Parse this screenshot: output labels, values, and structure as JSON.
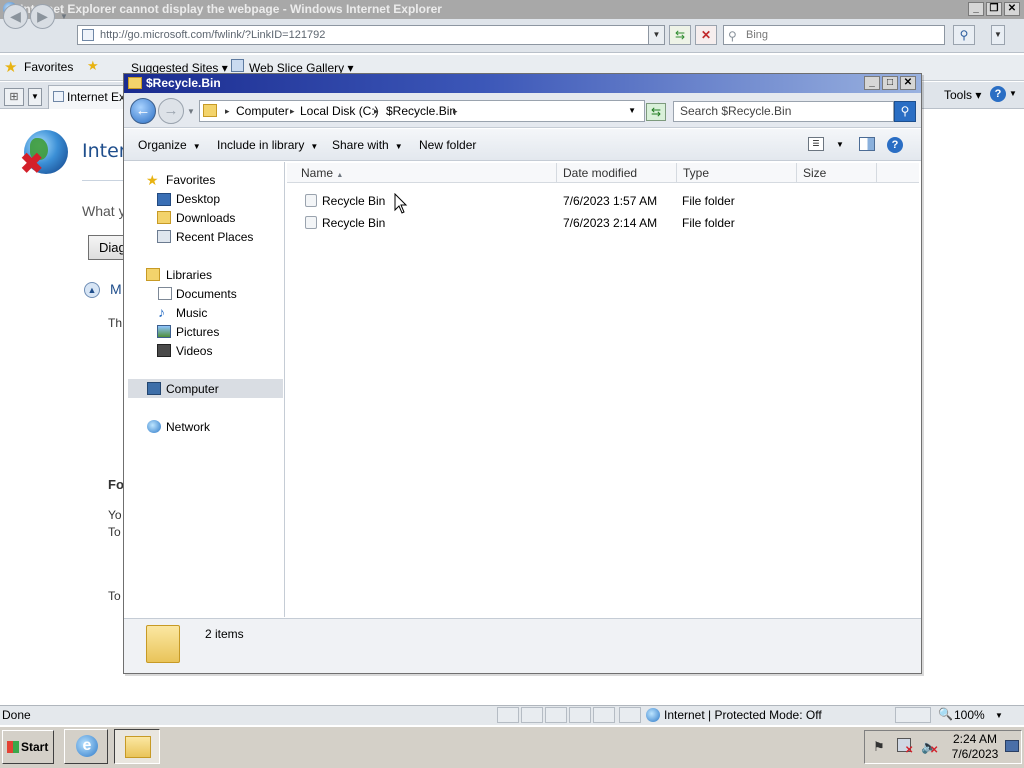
{
  "ie": {
    "title": "Internet Explorer cannot display the webpage - Windows Internet Explorer",
    "address": "http://go.microsoft.com/fwlink/?LinkID=121792",
    "search_placeholder": "Bing",
    "favorites_label": "Favorites",
    "suggested_sites": "Suggested Sites",
    "web_slice_gallery": "Web Slice Gallery",
    "tab_label": "Internet Ex",
    "tools_label": "Tools",
    "status_text": "Done",
    "zone_text": "Internet | Protected Mode: Off",
    "zoom_text": "100%",
    "page": {
      "title_fragment": "Intern",
      "what_fragment": "What y",
      "diag_fragment": "Diag",
      "more_fragment": "M",
      "th_fragment": "Th",
      "fo_fragment": "Fo",
      "yo_fragment": "Yo",
      "to_fragment_1": "To",
      "to_fragment_2": "To"
    }
  },
  "explorer": {
    "title": "$Recycle.Bin",
    "breadcrumb": [
      "Computer",
      "Local Disk (C:)",
      "$Recycle.Bin"
    ],
    "search_placeholder": "Search $Recycle.Bin",
    "commands": {
      "organize": "Organize",
      "include_in_library": "Include in library",
      "share_with": "Share with",
      "new_folder": "New folder"
    },
    "nav": {
      "favorites": "Favorites",
      "desktop": "Desktop",
      "downloads": "Downloads",
      "recent_places": "Recent Places",
      "libraries": "Libraries",
      "documents": "Documents",
      "music": "Music",
      "pictures": "Pictures",
      "videos": "Videos",
      "computer": "Computer",
      "network": "Network"
    },
    "columns": {
      "name": "Name",
      "date_modified": "Date modified",
      "type": "Type",
      "size": "Size"
    },
    "rows": [
      {
        "name": "Recycle Bin",
        "date": "7/6/2023 1:57 AM",
        "type": "File folder",
        "size": ""
      },
      {
        "name": "Recycle Bin",
        "date": "7/6/2023 2:14 AM",
        "type": "File folder",
        "size": ""
      }
    ],
    "item_count": "2 items"
  },
  "taskbar": {
    "start_label": "Start",
    "time": "2:24 AM",
    "date": "7/6/2023"
  },
  "colors": {
    "explorer_title_start": "#1a2b8f",
    "explorer_title_end": "#9ab2e0",
    "ie_title_inactive": "#a8a8a8",
    "selection": "#d9dde3"
  }
}
